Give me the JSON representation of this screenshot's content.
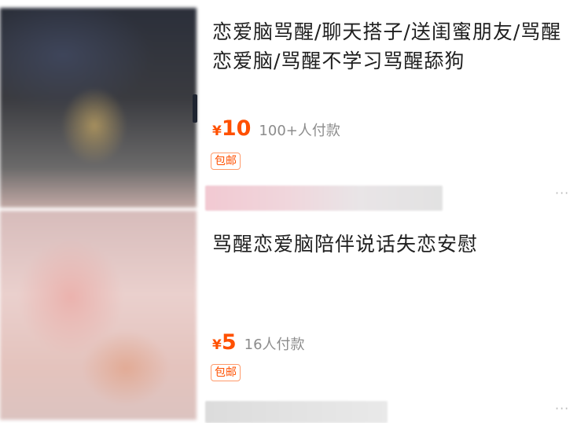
{
  "listings": [
    {
      "title": "恋爱脑骂醒/聊天搭子/送闺蜜朋友/骂醒恋爱脑/骂醒不学习骂醒舔狗",
      "price_symbol": "¥",
      "price": "10",
      "sales": "100+人付款",
      "badge": "包邮",
      "more_icon": "more-icon"
    },
    {
      "title": "骂醒恋爱脑陪伴说话失恋安慰",
      "price_symbol": "¥",
      "price": "5",
      "sales": "16人付款",
      "badge": "包邮",
      "more_icon": "more-icon"
    }
  ],
  "colors": {
    "price": "#ff5000",
    "sales": "#8c8c8c",
    "badge_border": "#ff9a6a"
  }
}
